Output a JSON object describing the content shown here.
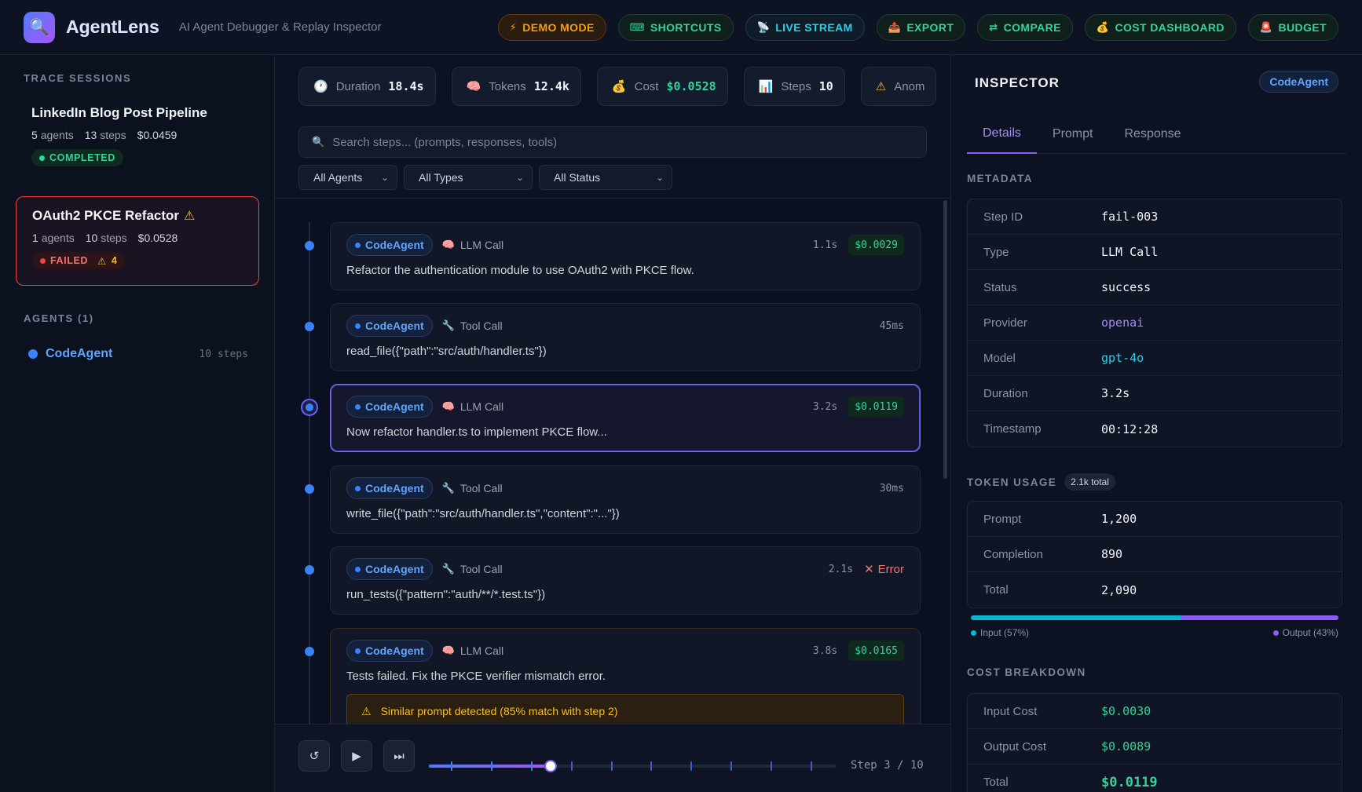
{
  "app": {
    "title": "AgentLens",
    "subtitle": "AI Agent Debugger & Replay Inspector"
  },
  "header_buttons": [
    {
      "label": "DEMO MODE",
      "icon": "⚡",
      "icon_name": "bolt-icon",
      "color": "#f59e0b",
      "bg": "#2a1c0e",
      "border": "#5b3a12"
    },
    {
      "label": "SHORTCUTS",
      "icon": "⌨",
      "icon_name": "keyboard-icon",
      "color": "#34d399",
      "bg": "#0f1f1c",
      "border": "#1f3d34"
    },
    {
      "label": "LIVE STREAM",
      "icon": "📡",
      "icon_name": "antenna-icon",
      "color": "#22d3ee",
      "bg": "#0f1c28",
      "border": "#1e3a4f"
    },
    {
      "label": "EXPORT",
      "icon": "📤",
      "icon_name": "export-icon",
      "color": "#34d399",
      "bg": "#0f1f1c",
      "border": "#1f3d34"
    },
    {
      "label": "COMPARE",
      "icon": "⇄",
      "icon_name": "compare-icon",
      "color": "#34d399",
      "bg": "#0f1f1c",
      "border": "#1f3d34"
    },
    {
      "label": "COST DASHBOARD",
      "icon": "💰",
      "icon_name": "money-bag-icon",
      "color": "#34d399",
      "bg": "#0f1f1c",
      "border": "#1f3d34"
    },
    {
      "label": "BUDGET",
      "icon": "🚨",
      "icon_name": "alarm-icon",
      "color": "#34d399",
      "bg": "#0f1f1c",
      "border": "#1f3d34"
    }
  ],
  "sidebar": {
    "sessions_label": "TRACE SESSIONS",
    "sessions": [
      {
        "title": "LinkedIn Blog Post Pipeline",
        "agents": "5",
        "agents_label": "agents",
        "steps": "13",
        "steps_label": "steps",
        "cost": "$0.0459",
        "status": "COMPLETED",
        "warn_count": ""
      },
      {
        "title": "OAuth2 PKCE Refactor",
        "agents": "1",
        "agents_label": "agents",
        "steps": "10",
        "steps_label": "steps",
        "cost": "$0.0528",
        "status": "FAILED",
        "warn_count": "4"
      }
    ],
    "agents_label": "AGENTS (1)",
    "agents": [
      {
        "name": "CodeAgent",
        "steps": "10 steps"
      }
    ]
  },
  "stats": [
    {
      "icon": "🕐",
      "icon_name": "clock-icon",
      "label": "Duration",
      "value": "18.4s",
      "value_color": "#f3f4f6"
    },
    {
      "icon": "🧠",
      "icon_name": "brain-icon",
      "label": "Tokens",
      "value": "12.4k",
      "value_color": "#f3f4f6"
    },
    {
      "icon": "💰",
      "icon_name": "money-bag-icon",
      "label": "Cost",
      "value": "$0.0528",
      "value_color": "#34d399"
    },
    {
      "icon": "📊",
      "icon_name": "bar-chart-icon",
      "label": "Steps",
      "value": "10",
      "value_color": "#f3f4f6"
    },
    {
      "icon": "⚠",
      "icon_name": "warning-icon",
      "label": "Anom",
      "value": "",
      "value_color": "#f3f4f6"
    }
  ],
  "search": {
    "placeholder": "Search steps... (prompts, responses, tools)",
    "icon": "🔍"
  },
  "filters": [
    "All Agents",
    "All Types",
    "All Status"
  ],
  "steps": [
    {
      "agent": "CodeAgent",
      "kind": "LLM Call",
      "kind_icon": "🧠",
      "kind_icon_name": "brain-icon",
      "duration": "1.1s",
      "cost": "$0.0029",
      "error": "",
      "text": "Refactor the authentication module to use OAuth2 with PKCE flow.",
      "warning": ""
    },
    {
      "agent": "CodeAgent",
      "kind": "Tool Call",
      "kind_icon": "🔧",
      "kind_icon_name": "wrench-icon",
      "duration": "45ms",
      "cost": "",
      "error": "",
      "text": "read_file({\"path\":\"src/auth/handler.ts\"})",
      "warning": ""
    },
    {
      "agent": "CodeAgent",
      "kind": "LLM Call",
      "kind_icon": "🧠",
      "kind_icon_name": "brain-icon",
      "duration": "3.2s",
      "cost": "$0.0119",
      "error": "",
      "text": "Now refactor handler.ts to implement PKCE flow...",
      "warning": ""
    },
    {
      "agent": "CodeAgent",
      "kind": "Tool Call",
      "kind_icon": "🔧",
      "kind_icon_name": "wrench-icon",
      "duration": "30ms",
      "cost": "",
      "error": "",
      "text": "write_file({\"path\":\"src/auth/handler.ts\",\"content\":\"...\"})",
      "warning": ""
    },
    {
      "agent": "CodeAgent",
      "kind": "Tool Call",
      "kind_icon": "🔧",
      "kind_icon_name": "wrench-icon",
      "duration": "2.1s",
      "cost": "",
      "error": "Error",
      "text": "run_tests({\"pattern\":\"auth/**/*.test.ts\"})",
      "warning": ""
    },
    {
      "agent": "CodeAgent",
      "kind": "LLM Call",
      "kind_icon": "🧠",
      "kind_icon_name": "brain-icon",
      "duration": "3.8s",
      "cost": "$0.0165",
      "error": "",
      "text": "Tests failed. Fix the PKCE verifier mismatch error.",
      "warning": "Similar prompt detected (85% match with step 2)"
    }
  ],
  "playback": {
    "step_label": "Step 3 / 10",
    "current_step": 3,
    "total_steps": 10,
    "progress_fraction": 0.3
  },
  "inspector": {
    "title": "INSPECTOR",
    "agent": "CodeAgent",
    "tabs": [
      "Details",
      "Prompt",
      "Response"
    ],
    "active_tab": "Details",
    "metadata_label": "METADATA",
    "metadata": [
      {
        "key": "Step ID",
        "value": "fail-003",
        "color": "#f3f4f6"
      },
      {
        "key": "Type",
        "value": "LLM Call",
        "color": "#f3f4f6"
      },
      {
        "key": "Status",
        "value": "success",
        "color": "#f3f4f6"
      },
      {
        "key": "Provider",
        "value": "openai",
        "color": "#a78bfa"
      },
      {
        "key": "Model",
        "value": "gpt-4o",
        "color": "#22d3ee"
      },
      {
        "key": "Duration",
        "value": "3.2s",
        "color": "#f3f4f6"
      },
      {
        "key": "Timestamp",
        "value": "00:12:28",
        "color": "#f3f4f6"
      }
    ],
    "token_label": "TOKEN USAGE",
    "token_total_chip": "2.1k total",
    "tokens": [
      {
        "key": "Prompt",
        "value": "1,200"
      },
      {
        "key": "Completion",
        "value": "890"
      },
      {
        "key": "Total",
        "value": "2,090"
      }
    ],
    "token_split": {
      "input_fraction": 0.57,
      "output_fraction": 0.43,
      "input_label": "Input (57%)",
      "output_label": "Output (43%)",
      "input_color": "#06b6d4",
      "output_color": "#8b5cf6"
    },
    "cost_label": "COST BREAKDOWN",
    "costs": [
      {
        "key": "Input Cost",
        "value": "$0.0030"
      },
      {
        "key": "Output Cost",
        "value": "$0.0089"
      },
      {
        "key": "Total",
        "value": "$0.0119"
      }
    ]
  }
}
